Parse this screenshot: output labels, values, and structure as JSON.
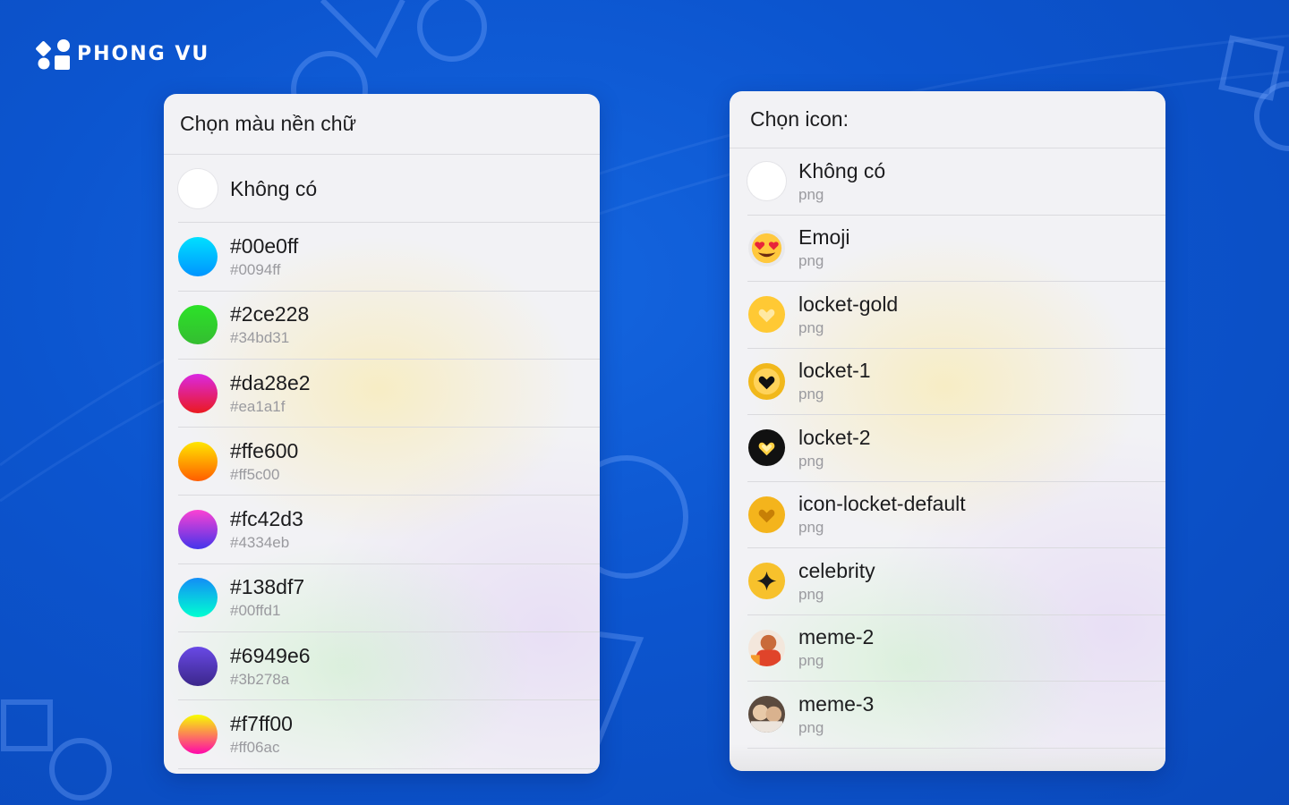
{
  "brand": {
    "name": "PHONG VU"
  },
  "left_panel": {
    "title": "Chọn màu nền chữ",
    "items": [
      {
        "title": "Không có",
        "subtitle": "",
        "color_top": "#ffffff",
        "color_bottom": "#ffffff"
      },
      {
        "title": "#00e0ff",
        "subtitle": "#0094ff",
        "color_top": "#00e0ff",
        "color_bottom": "#0094ff"
      },
      {
        "title": "#2ce228",
        "subtitle": "#34bd31",
        "color_top": "#2ce228",
        "color_bottom": "#34bd31"
      },
      {
        "title": "#da28e2",
        "subtitle": "#ea1a1f",
        "color_top": "#da28e2",
        "color_bottom": "#ea1a1f"
      },
      {
        "title": "#ffe600",
        "subtitle": "#ff5c00",
        "color_top": "#ffe600",
        "color_bottom": "#ff5c00"
      },
      {
        "title": "#fc42d3",
        "subtitle": "#4334eb",
        "color_top": "#fc42d3",
        "color_bottom": "#4334eb"
      },
      {
        "title": "#138df7",
        "subtitle": "#00ffd1",
        "color_top": "#138df7",
        "color_bottom": "#00ffd1"
      },
      {
        "title": "#6949e6",
        "subtitle": "#3b278a",
        "color_top": "#6949e6",
        "color_bottom": "#3b278a"
      },
      {
        "title": "#f7ff00",
        "subtitle": "#ff06ac",
        "color_top": "#f7ff00",
        "color_bottom": "#ff06ac"
      }
    ]
  },
  "right_panel": {
    "title": "Chọn icon:",
    "items": [
      {
        "title": "Không có",
        "subtitle": "png",
        "icon": "blank-icon"
      },
      {
        "title": "Emoji",
        "subtitle": "png",
        "icon": "heart-eyes-emoji-icon"
      },
      {
        "title": "locket-gold",
        "subtitle": "png",
        "icon": "gold-heart-locket-icon"
      },
      {
        "title": "locket-1",
        "subtitle": "png",
        "icon": "black-heart-gold-locket-icon"
      },
      {
        "title": "locket-2",
        "subtitle": "png",
        "icon": "gold-heart-black-locket-icon"
      },
      {
        "title": "icon-locket-default",
        "subtitle": "png",
        "icon": "default-locket-icon"
      },
      {
        "title": "celebrity",
        "subtitle": "png",
        "icon": "sparkle-star-icon"
      },
      {
        "title": "meme-2",
        "subtitle": "png",
        "icon": "meme-2-thumbnail-icon"
      },
      {
        "title": "meme-3",
        "subtitle": "png",
        "icon": "meme-3-thumbnail-icon"
      }
    ]
  }
}
